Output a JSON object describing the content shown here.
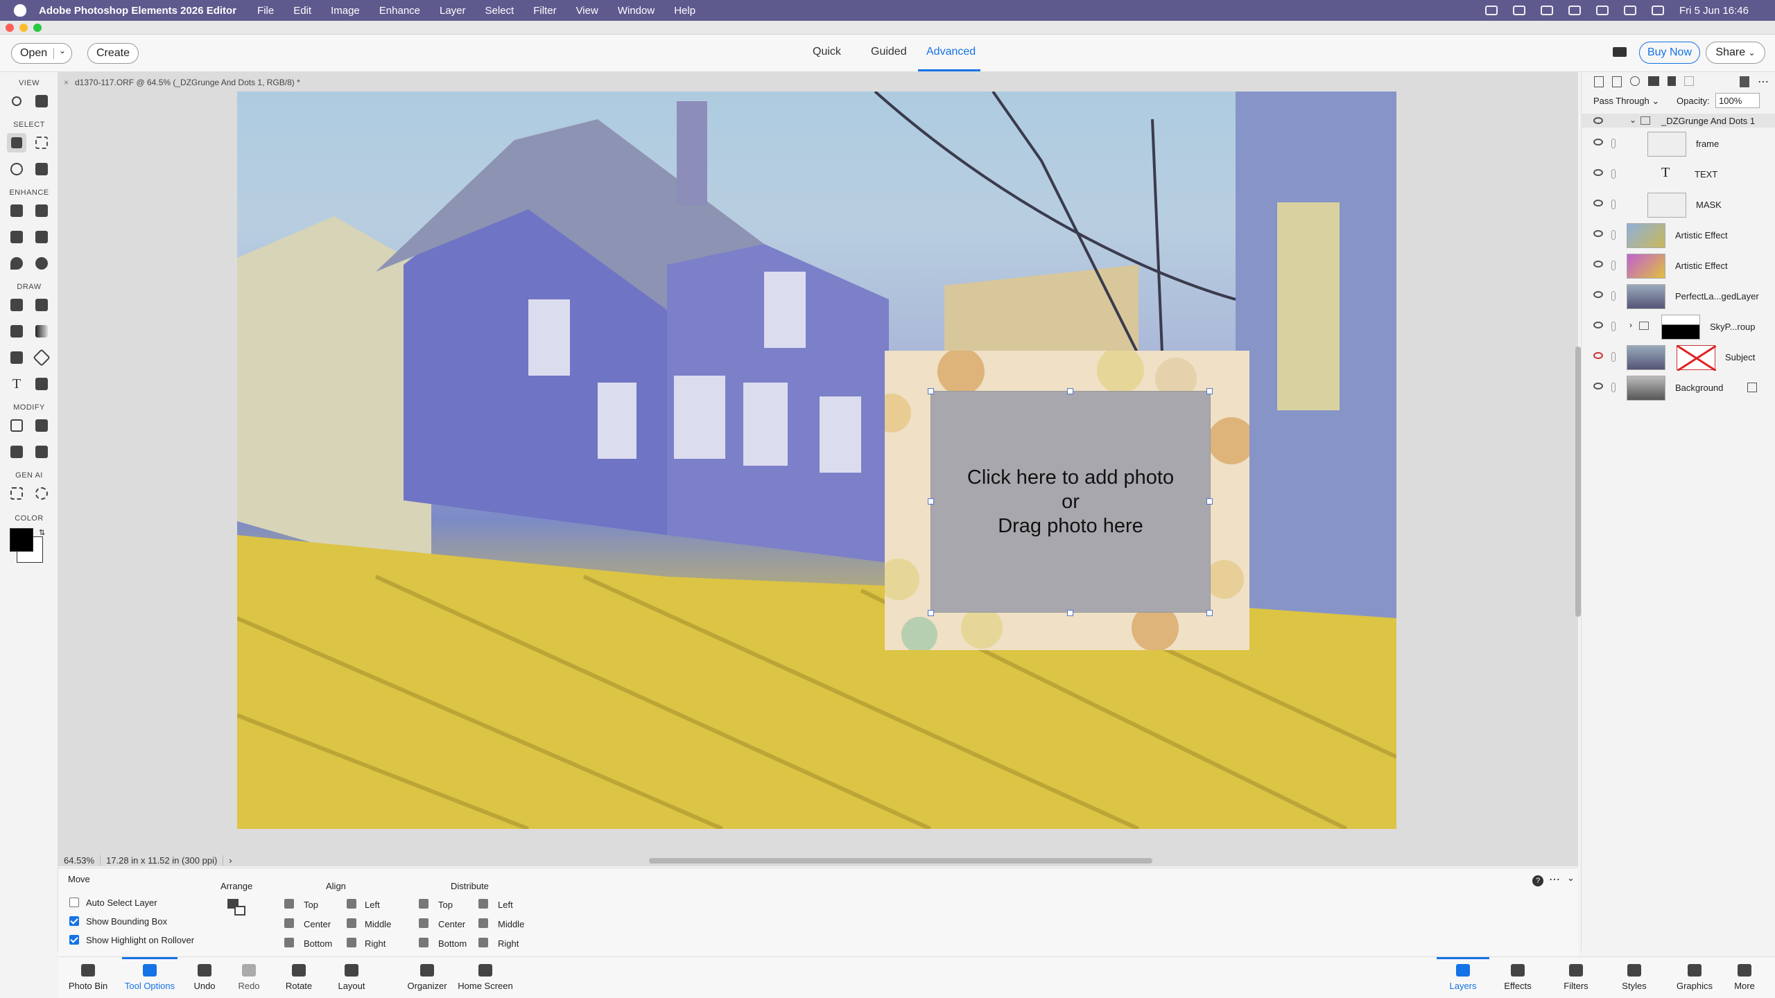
{
  "menubar": {
    "app_name": "Adobe Photoshop Elements 2026 Editor",
    "items": [
      "File",
      "Edit",
      "Image",
      "Enhance",
      "Layer",
      "Select",
      "Filter",
      "View",
      "Window",
      "Help"
    ],
    "clock": "Fri 5 Jun  16:46"
  },
  "topbar": {
    "open_label": "Open",
    "create_label": "Create",
    "modes": [
      "Quick",
      "Guided",
      "Advanced"
    ],
    "active_mode": "Advanced",
    "buy_now_label": "Buy Now",
    "share_label": "Share"
  },
  "tools": {
    "sections": [
      "VIEW",
      "SELECT",
      "ENHANCE",
      "DRAW",
      "MODIFY",
      "GEN AI",
      "COLOR"
    ]
  },
  "document": {
    "tab_title": "d1370-117.ORF @ 64.5% (_DZGrunge And Dots 1, RGB/8) *",
    "placeholder_line1": "Click here to add photo",
    "placeholder_line2": "or",
    "placeholder_line3": "Drag photo here",
    "zoom": "64.53%",
    "doc_size": "17.28 in x 11.52 in (300 ppi)"
  },
  "layers": {
    "blend_mode": "Pass Through",
    "opacity_label": "Opacity:",
    "opacity_value": "100%",
    "items": [
      {
        "name": "_DZGrunge And Dots 1"
      },
      {
        "name": "frame"
      },
      {
        "name": "TEXT"
      },
      {
        "name": "MASK"
      },
      {
        "name": "Artistic Effect"
      },
      {
        "name": "Artistic Effect"
      },
      {
        "name": "PerfectLa...gedLayer"
      },
      {
        "name": "SkyP...roup"
      },
      {
        "name": "Subject"
      },
      {
        "name": "Background"
      }
    ]
  },
  "tool_options": {
    "tool_name": "Move",
    "auto_select": "Auto Select Layer",
    "show_bbox": "Show Bounding Box",
    "show_highlight": "Show Highlight on Rollover",
    "arrange_label": "Arrange",
    "align_label": "Align",
    "distribute_label": "Distribute",
    "align": {
      "top": "Top",
      "center": "Center",
      "bottom": "Bottom",
      "left": "Left",
      "middle": "Middle",
      "right": "Right"
    },
    "distribute": {
      "top": "Top",
      "center": "Center",
      "bottom": "Bottom",
      "left": "Left",
      "middle": "Middle",
      "right": "Right"
    }
  },
  "taskbar": {
    "left": [
      "Photo Bin",
      "Tool Options",
      "Undo",
      "Redo",
      "Rotate",
      "Layout",
      "Organizer",
      "Home Screen"
    ],
    "right": [
      "Layers",
      "Effects",
      "Filters",
      "Styles",
      "Graphics",
      "More"
    ]
  },
  "colors": {
    "accent": "#1473e6",
    "menubar": "#5e5a8e"
  }
}
